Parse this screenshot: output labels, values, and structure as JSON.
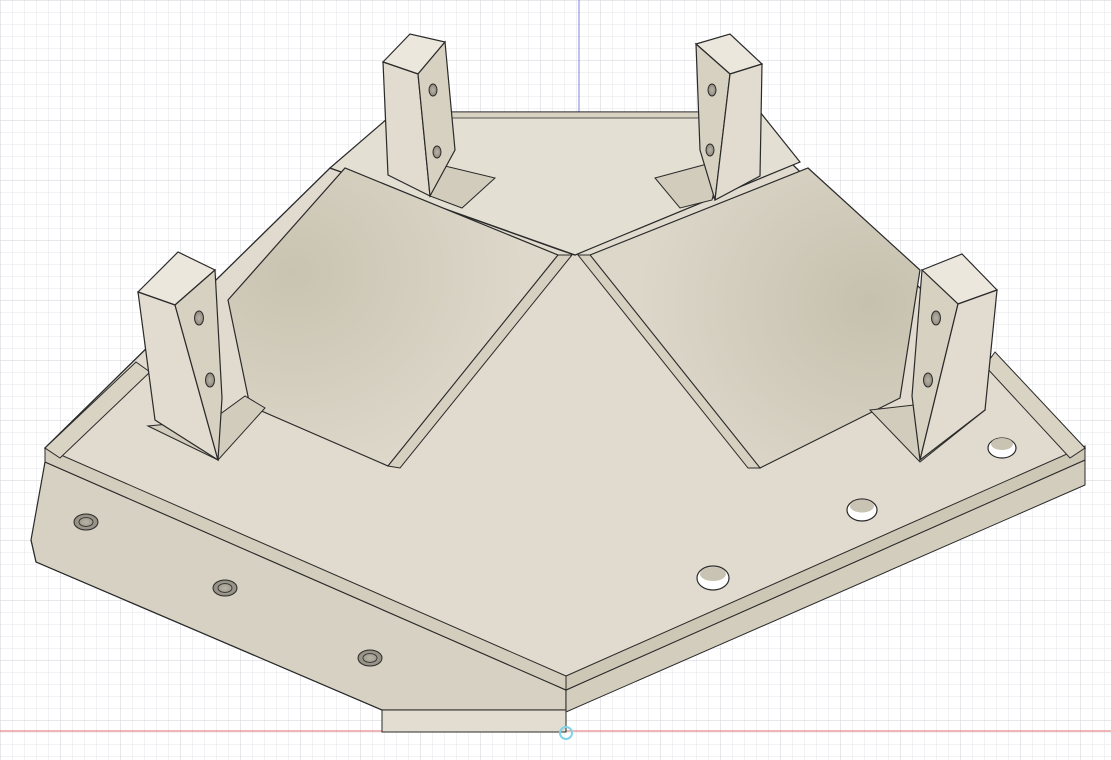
{
  "viewport": {
    "kind": "3d-cad-viewport",
    "background_color": "#ffffff",
    "grid_minor_color": "#e4e6ea",
    "grid_major_color": "#c9ccd2",
    "axis_x_color": "#e06b6b",
    "axis_z_color": "#6b7be0",
    "origin_color": "#7fd3e6"
  },
  "model": {
    "name_icon": "sheet-metal-bracket-part",
    "body_color": "#ddd8ca",
    "body_shade_color": "#cfc9b8",
    "body_light_color": "#e8e4d8",
    "edge_color": "#2a2a2a",
    "features": {
      "mounting_tabs": 4,
      "threaded_holes": 3,
      "through_holes": 3,
      "pyramid_panels": 2
    }
  }
}
